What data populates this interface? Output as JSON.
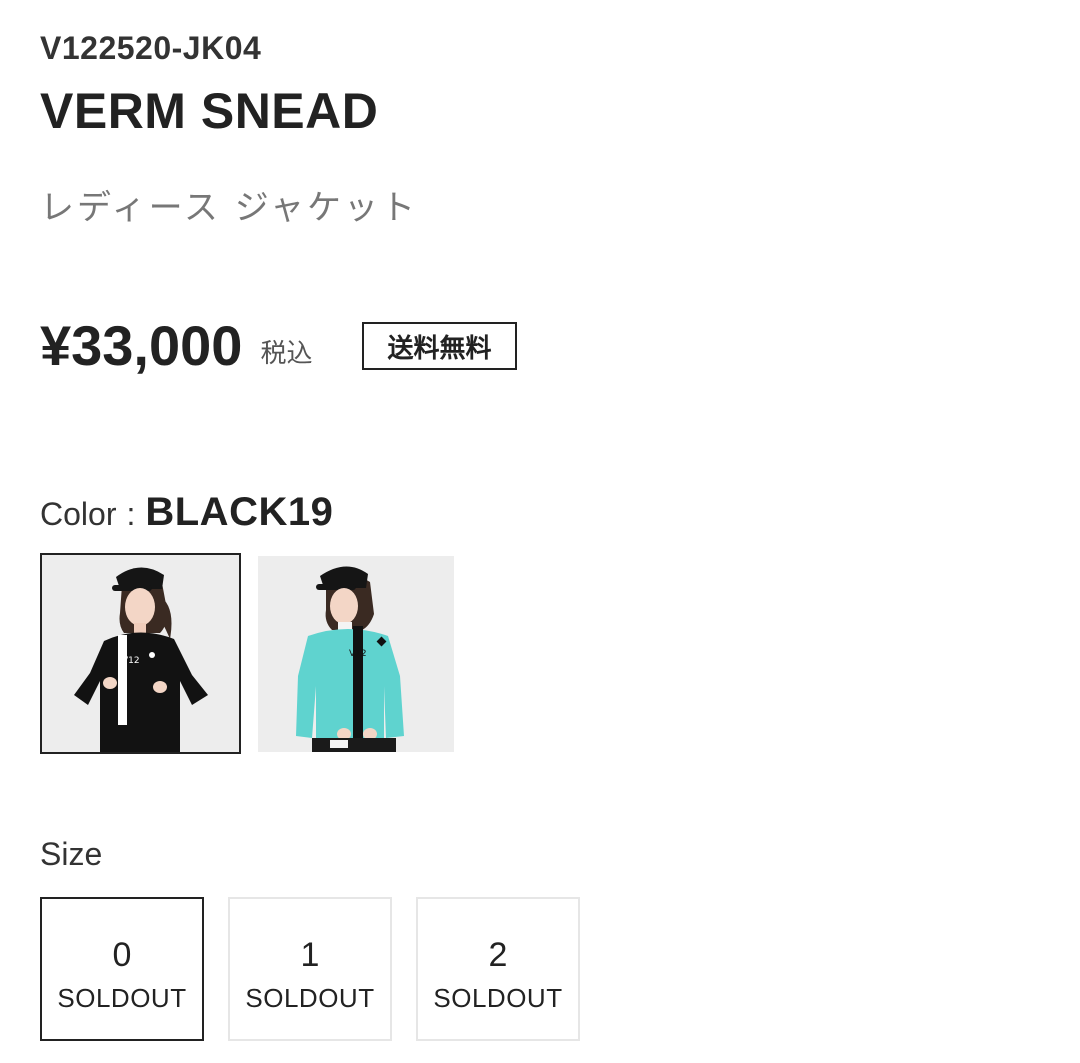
{
  "product": {
    "sku": "V122520-JK04",
    "name": "VERM SNEAD",
    "category": "レディース ジャケット",
    "price": "¥33,000",
    "tax_note": "税込",
    "shipping_badge": "送料無料"
  },
  "color": {
    "label": "Color",
    "separator": ":",
    "selected": "BLACK19",
    "swatches": [
      {
        "name": "black-jacket",
        "main_color": "#111111",
        "stripe_color": "#ffffff",
        "selected": true
      },
      {
        "name": "mint-sweater",
        "main_color": "#5fd3cf",
        "stripe_color": "#111111",
        "selected": false
      }
    ],
    "logo_text": "V12"
  },
  "size": {
    "label": "Size",
    "options": [
      {
        "value": "0",
        "status": "SOLDOUT",
        "selected": true
      },
      {
        "value": "1",
        "status": "SOLDOUT",
        "selected": false
      },
      {
        "value": "2",
        "status": "SOLDOUT",
        "selected": false
      }
    ]
  }
}
